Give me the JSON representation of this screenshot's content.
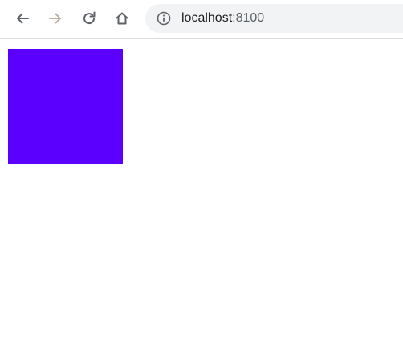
{
  "browser": {
    "url_host": "localhost",
    "url_port": ":8100",
    "back_icon": "arrow-left-icon",
    "forward_icon": "arrow-right-icon",
    "reload_icon": "reload-icon",
    "home_icon": "home-icon",
    "info_icon": "info-circle-icon"
  },
  "page": {
    "box_color": "#5b00ff"
  }
}
